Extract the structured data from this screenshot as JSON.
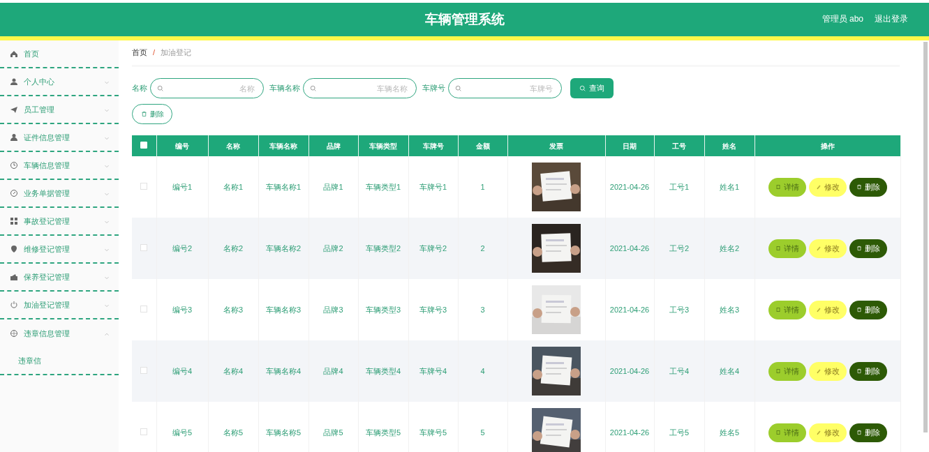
{
  "header": {
    "title": "车辆管理系统",
    "user": "管理员 abo",
    "logout": "退出登录"
  },
  "sidebar": {
    "items": [
      {
        "label": "首页",
        "has_caret": false,
        "expanded": false
      },
      {
        "label": "个人中心",
        "has_caret": true,
        "expanded": false
      },
      {
        "label": "员工管理",
        "has_caret": true,
        "expanded": false
      },
      {
        "label": "证件信息管理",
        "has_caret": true,
        "expanded": false
      },
      {
        "label": "车辆信息管理",
        "has_caret": true,
        "expanded": false
      },
      {
        "label": "业务单据管理",
        "has_caret": true,
        "expanded": false
      },
      {
        "label": "事故登记管理",
        "has_caret": true,
        "expanded": false
      },
      {
        "label": "维修登记管理",
        "has_caret": true,
        "expanded": false
      },
      {
        "label": "保养登记管理",
        "has_caret": true,
        "expanded": false
      },
      {
        "label": "加油登记管理",
        "has_caret": true,
        "expanded": false
      },
      {
        "label": "违章信息管理",
        "has_caret": true,
        "expanded": true,
        "children": [
          {
            "label": "违章信"
          }
        ]
      }
    ]
  },
  "breadcrumb": [
    {
      "label": "首页"
    },
    {
      "label": "加油登记"
    }
  ],
  "breadcrumb_separator": "/",
  "search": {
    "fields": [
      {
        "label": "名称",
        "placeholder": "名称"
      },
      {
        "label": "车辆名称",
        "placeholder": "车辆名称"
      },
      {
        "label": "车牌号",
        "placeholder": "车牌号"
      }
    ],
    "button": "查询"
  },
  "delete_button": "删除",
  "table": {
    "columns": [
      "编号",
      "名称",
      "车辆名称",
      "品牌",
      "车辆类型",
      "车牌号",
      "金额",
      "发票",
      "日期",
      "工号",
      "姓名",
      "操作"
    ],
    "select_all": false,
    "rows": [
      {
        "selected": false,
        "cells": [
          "编号1",
          "名称1",
          "车辆名称1",
          "品牌1",
          "车辆类型1",
          "车牌号1",
          "1",
          {
            "kind": "picture"
          },
          "2021-04-26",
          "工号1",
          "姓名1"
        ],
        "actions": [
          "详情",
          "修改",
          "删除"
        ]
      },
      {
        "selected": false,
        "cells": [
          "编号2",
          "名称2",
          "车辆名称2",
          "品牌2",
          "车辆类型2",
          "车牌号2",
          "2",
          {
            "kind": "picture"
          },
          "2021-04-26",
          "工号2",
          "姓名2"
        ],
        "actions": [
          "详情",
          "修改",
          "删除"
        ]
      },
      {
        "selected": false,
        "cells": [
          "编号3",
          "名称3",
          "车辆名称3",
          "品牌3",
          "车辆类型3",
          "车牌号3",
          "3",
          {
            "kind": "picture"
          },
          "2021-04-26",
          "工号3",
          "姓名3"
        ],
        "actions": [
          "详情",
          "修改",
          "删除"
        ]
      },
      {
        "selected": false,
        "cells": [
          "编号4",
          "名称4",
          "车辆名称4",
          "品牌4",
          "车辆类型4",
          "车牌号4",
          "4",
          {
            "kind": "picture"
          },
          "2021-04-26",
          "工号4",
          "姓名4"
        ],
        "actions": [
          "详情",
          "修改",
          "删除"
        ]
      },
      {
        "selected": false,
        "cells": [
          "编号5",
          "名称5",
          "车辆名称5",
          "品牌5",
          "车辆类型5",
          "车牌号5",
          "5",
          {
            "kind": "picture"
          },
          "2021-04-26",
          "工号5",
          "姓名5"
        ],
        "actions": [
          "详情",
          "修改",
          "删除"
        ]
      }
    ]
  }
}
